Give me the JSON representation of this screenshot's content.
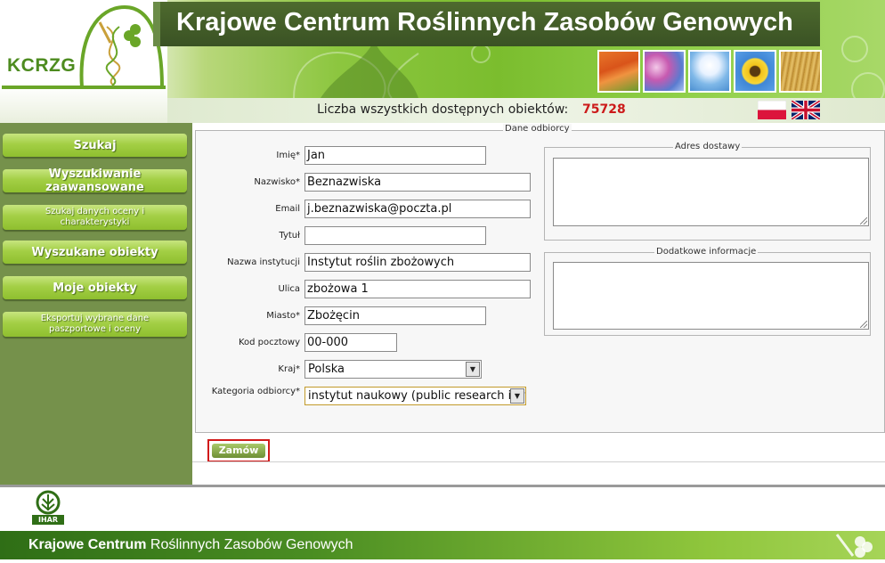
{
  "header": {
    "logo_text": "KCRZG",
    "title": "Krajowe Centrum Roślinnych Zasobów Genowych",
    "photos": [
      "carrots-photo",
      "flowers-photo",
      "umbel-photo",
      "sunflower-photo",
      "grain-photo"
    ]
  },
  "count": {
    "label": "Liczba wszystkich dostępnych obiektów:",
    "value": "75728"
  },
  "sidebar": {
    "items": [
      {
        "label": "Szukaj"
      },
      {
        "label": "Wyszukiwanie zaawansowane"
      },
      {
        "label": "Szukaj danych oceny i charakterystyki"
      },
      {
        "label": "Wyszukane obiekty"
      },
      {
        "label": "Moje obiekty"
      },
      {
        "label": "Eksportuj wybrane dane paszportowe i oceny"
      }
    ]
  },
  "form": {
    "legend": "Dane odbiorcy",
    "fields": [
      {
        "label": "Imię*",
        "value": "Jan"
      },
      {
        "label": "Nazwisko*",
        "value": "Beznazwiska"
      },
      {
        "label": "Email",
        "value": "j.beznazwiska@poczta.pl"
      },
      {
        "label": "Tytuł",
        "value": ""
      },
      {
        "label": "Nazwa instytucji",
        "value": "Instytut roślin zbożowych"
      },
      {
        "label": "Ulica",
        "value": "zbożowa 1"
      },
      {
        "label": "Miasto*",
        "value": "Zbożęcin"
      },
      {
        "label": "Kod pocztowy",
        "value": "00-000"
      },
      {
        "label": "Kraj*",
        "value": "Polska"
      },
      {
        "label": "Kategoria odbiorcy*",
        "value": "instytut naukowy (public research inst"
      }
    ],
    "delivery_legend": "Adres dostawy",
    "extra_legend": "Dodatkowe informacje",
    "submit_label": "Zamów"
  },
  "footer": {
    "title_bold": "Krajowe Centrum",
    "title_rest": " Roślinnych Zasobów Genowych",
    "logo_text": "IHAR"
  },
  "colors": {
    "accent_green": "#8cc63f",
    "sidebar_bg": "#75914b",
    "count_red": "#cc1a1a",
    "highlight_red": "#d11a1a"
  }
}
